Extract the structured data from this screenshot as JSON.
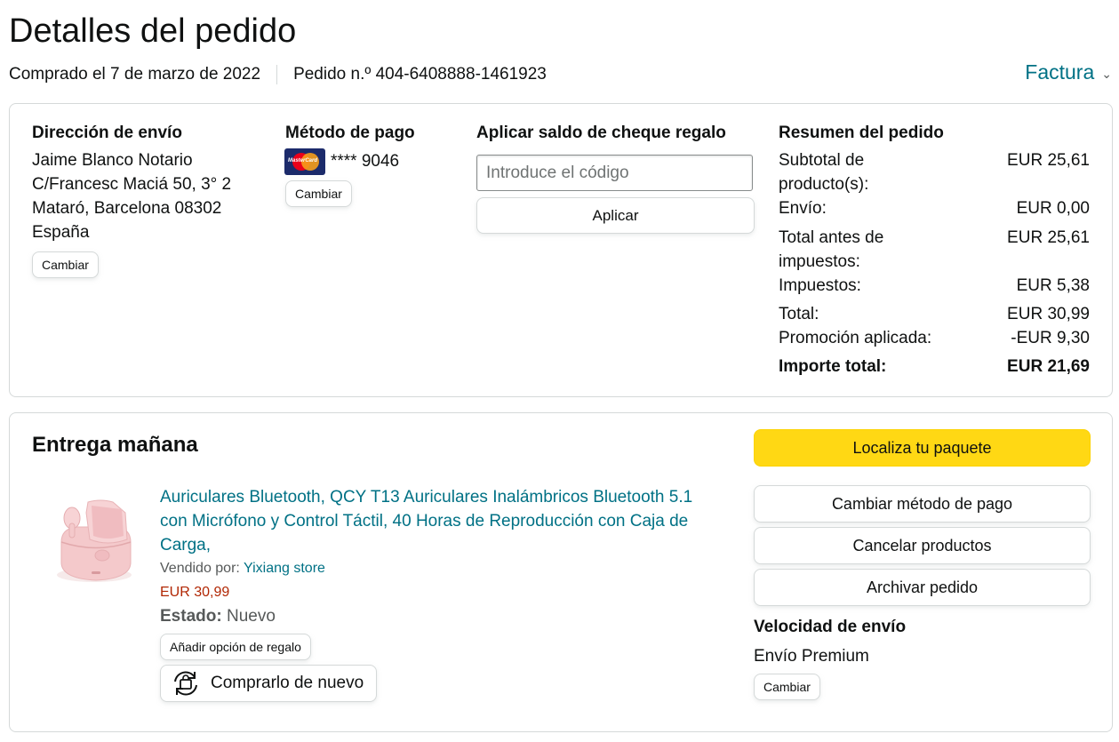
{
  "header": {
    "title": "Detalles del pedido",
    "purchased": "Comprado el 7 de marzo de 2022",
    "order_number": "Pedido n.º 404-6408888-1461923",
    "invoice_label": "Factura",
    "invoice_chevron": "⌄"
  },
  "shipping": {
    "title": "Dirección de envío",
    "name": "Jaime Blanco Notario",
    "street": "C/Francesc Maciá 50, 3° 2",
    "city": "Mataró, Barcelona 08302",
    "country": "España",
    "change_label": "Cambiar"
  },
  "payment": {
    "title": "Método de pago",
    "card_brand_text": "MasterCard",
    "card_number": "**** 9046",
    "change_label": "Cambiar"
  },
  "gift": {
    "title": "Aplicar saldo de cheque regalo",
    "placeholder": "Introduce el código",
    "apply_label": "Aplicar"
  },
  "summary": {
    "title": "Resumen del pedido",
    "subtotal_label": "Subtotal de producto(s):",
    "subtotal_value": "EUR 25,61",
    "shipping_label": "Envío:",
    "shipping_value": "EUR 0,00",
    "pretax_label": "Total antes de impuestos:",
    "pretax_value": "EUR 25,61",
    "tax_label": "Impuestos:",
    "tax_value": "EUR 5,38",
    "total_label": "Total:",
    "total_value": "EUR 30,99",
    "promo_label": "Promoción aplicada:",
    "promo_value": "-EUR 9,30",
    "grand_label": "Importe total:",
    "grand_value": "EUR 21,69"
  },
  "delivery": {
    "title": "Entrega mañana",
    "product_title": "Auriculares Bluetooth, QCY T13 Auriculares Inalámbricos Bluetooth 5.1 con Micrófono y Control Táctil, 40 Horas de Reproducción con Caja de Carga,",
    "sold_by_label": "Vendido por:",
    "seller": "Yixiang store",
    "price": "EUR 30,99",
    "state_label": "Estado:",
    "state_value": "Nuevo",
    "gift_option_label": "Añadir opción de regalo",
    "buy_again_label": "Comprarlo de nuevo",
    "track_label": "Localiza tu paquete",
    "change_payment_label": "Cambiar método de pago",
    "cancel_label": "Cancelar productos",
    "archive_label": "Archivar pedido",
    "speed_title": "Velocidad de envío",
    "speed_value": "Envío Premium",
    "speed_change_label": "Cambiar"
  }
}
